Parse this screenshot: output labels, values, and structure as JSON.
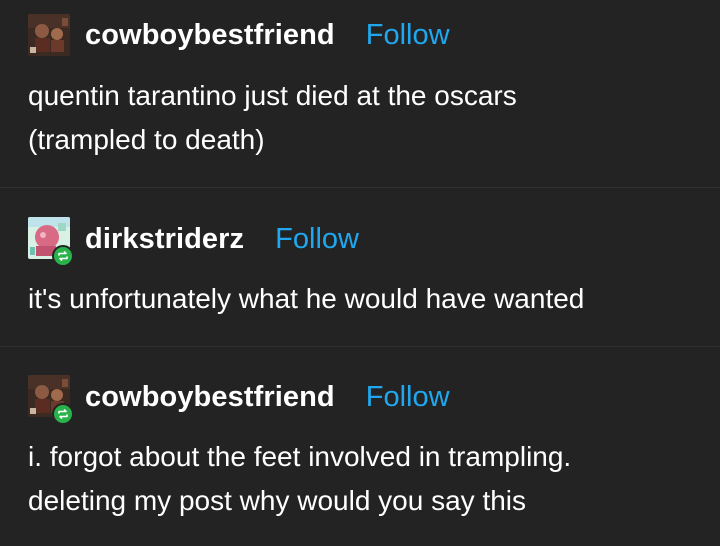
{
  "posts": [
    {
      "username": "cowboybestfriend",
      "follow_label": "Follow",
      "lines": [
        "quentin tarantino just died at the oscars",
        "(trampled to death)"
      ],
      "reblogged": false
    },
    {
      "username": "dirkstriderz",
      "follow_label": "Follow",
      "lines": [
        "it's unfortunately what he would have wanted"
      ],
      "reblogged": true
    },
    {
      "username": "cowboybestfriend",
      "follow_label": "Follow",
      "lines": [
        "i. forgot about the feet involved in trampling.",
        "deleting my post why would you say this"
      ],
      "reblogged": true
    }
  ],
  "icons": {
    "reblog": "reblog-icon",
    "avatar": "avatar"
  },
  "colors": {
    "background": "#232323",
    "text": "#ffffff",
    "follow_link": "#1fa8f0",
    "reblog_badge": "#2ab24a",
    "divider": "#2f2f2f"
  }
}
